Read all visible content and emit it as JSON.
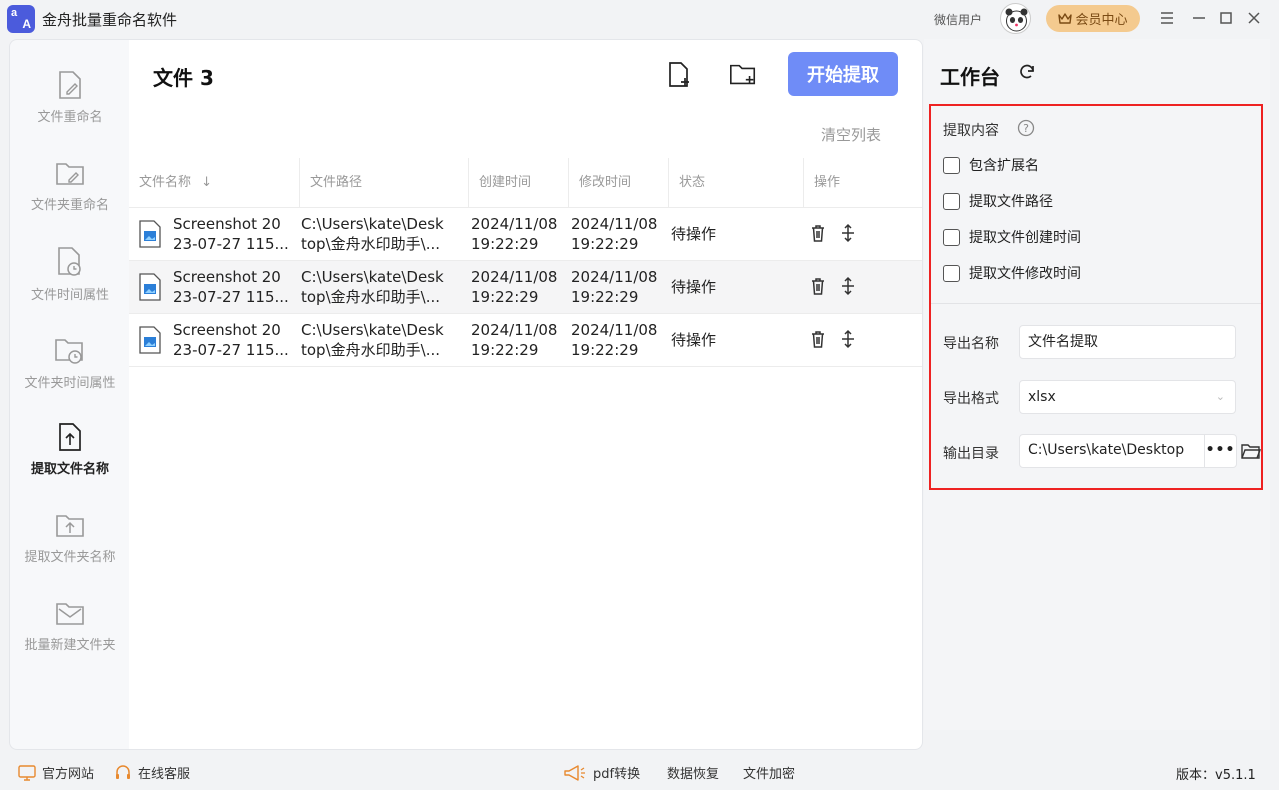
{
  "app": {
    "title": "金舟批量重命名软件",
    "logo_text_1": "a",
    "logo_text_2": "A"
  },
  "header": {
    "user_label": "微信用户",
    "vip_label": "会员中心"
  },
  "nav": {
    "items": [
      {
        "label": "文件重命名",
        "icon": "file-edit-icon"
      },
      {
        "label": "文件夹重命名",
        "icon": "folder-edit-icon"
      },
      {
        "label": "文件时间属性",
        "icon": "file-clock-icon"
      },
      {
        "label": "文件夹时间属性",
        "icon": "folder-clock-icon"
      },
      {
        "label": "提取文件名称",
        "icon": "file-upload-icon",
        "active": true
      },
      {
        "label": "提取文件夹名称",
        "icon": "folder-upload-icon"
      },
      {
        "label": "批量新建文件夹",
        "icon": "mail-folder-icon"
      }
    ]
  },
  "main": {
    "title": "文件 3",
    "start_button": "开始提取",
    "clear_list": "清空列表",
    "columns": [
      "文件名称",
      "文件路径",
      "创建时间",
      "修改时间",
      "状态",
      "操作"
    ],
    "rows": [
      {
        "name1": "Screenshot 20",
        "name2": "23-07-27 115...",
        "path1": "C:\\Users\\kate\\Desk",
        "path2": "top\\金舟水印助手\\...",
        "created1": "2024/11/08",
        "created2": "19:22:29",
        "modified1": "2024/11/08",
        "modified2": "19:22:29",
        "status": "待操作"
      },
      {
        "name1": "Screenshot 20",
        "name2": "23-07-27 115...",
        "path1": "C:\\Users\\kate\\Desk",
        "path2": "top\\金舟水印助手\\...",
        "created1": "2024/11/08",
        "created2": "19:22:29",
        "modified1": "2024/11/08",
        "modified2": "19:22:29",
        "status": "待操作"
      },
      {
        "name1": "Screenshot 20",
        "name2": "23-07-27 115...",
        "path1": "C:\\Users\\kate\\Desk",
        "path2": "top\\金舟水印助手\\...",
        "created1": "2024/11/08",
        "created2": "19:22:29",
        "modified1": "2024/11/08",
        "modified2": "19:22:29",
        "status": "待操作"
      }
    ]
  },
  "workspace": {
    "title": "工作台",
    "extract_label": "提取内容",
    "options": [
      "包含扩展名",
      "提取文件路径",
      "提取文件创建时间",
      "提取文件修改时间"
    ],
    "export_name_label": "导出名称",
    "export_name_value": "文件名提取",
    "export_format_label": "导出格式",
    "export_format_value": "xlsx",
    "output_dir_label": "输出目录",
    "output_dir_value": "C:\\Users\\kate\\Desktop",
    "more_label": "•••"
  },
  "footer": {
    "website": "官方网站",
    "support": "在线客服",
    "pdf": "pdf转换",
    "recovery": "数据恢复",
    "encrypt": "文件加密",
    "version": "版本：v5.1.1"
  },
  "colors": {
    "accent": "#6f8cf7",
    "highlight_border": "#e22222",
    "vip": "#f4ca8f"
  }
}
